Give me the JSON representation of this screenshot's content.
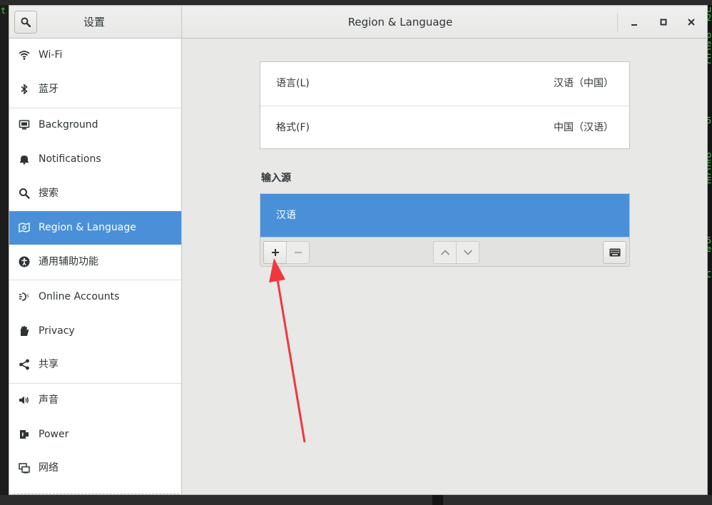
{
  "terminal": {
    "left_glyph": "t",
    "right_glyphs": [
      "u",
      "2",
      "",
      "p",
      "e",
      "C",
      "C",
      "",
      "",
      "",
      "",
      "",
      "",
      "5",
      "",
      "",
      "",
      "p",
      "E",
      "C",
      "E",
      "",
      "",
      "",
      "",
      "",
      "",
      "5",
      "e",
      "",
      "",
      "C"
    ]
  },
  "window": {
    "sidebar_title": "设置",
    "title": "Region & Language"
  },
  "sidebar": {
    "items": [
      {
        "label": "Wi-Fi",
        "icon": "wifi-icon"
      },
      {
        "label": "蓝牙",
        "icon": "bluetooth-icon"
      },
      {
        "label": "Background",
        "icon": "background-icon"
      },
      {
        "label": "Notifications",
        "icon": "bell-icon"
      },
      {
        "label": "搜索",
        "icon": "search-icon"
      },
      {
        "label": "Region & Language",
        "icon": "region-icon",
        "active": true
      },
      {
        "label": "通用辅助功能",
        "icon": "accessibility-icon"
      },
      {
        "label": "Online Accounts",
        "icon": "online-accounts-icon"
      },
      {
        "label": "Privacy",
        "icon": "privacy-hand-icon"
      },
      {
        "label": "共享",
        "icon": "share-icon"
      },
      {
        "label": "声音",
        "icon": "speaker-icon"
      },
      {
        "label": "Power",
        "icon": "power-icon"
      },
      {
        "label": "网络",
        "icon": "network-icon"
      }
    ]
  },
  "region": {
    "language_label": "语言(L)",
    "language_value": "汉语（中国）",
    "formats_label": "格式(F)",
    "formats_value": "中国（汉语）"
  },
  "input_sources": {
    "title": "输入源",
    "items": [
      "汉语"
    ],
    "selected": 0
  },
  "colors": {
    "accent": "#4a90d9",
    "annotation_arrow": "#f0383c"
  }
}
